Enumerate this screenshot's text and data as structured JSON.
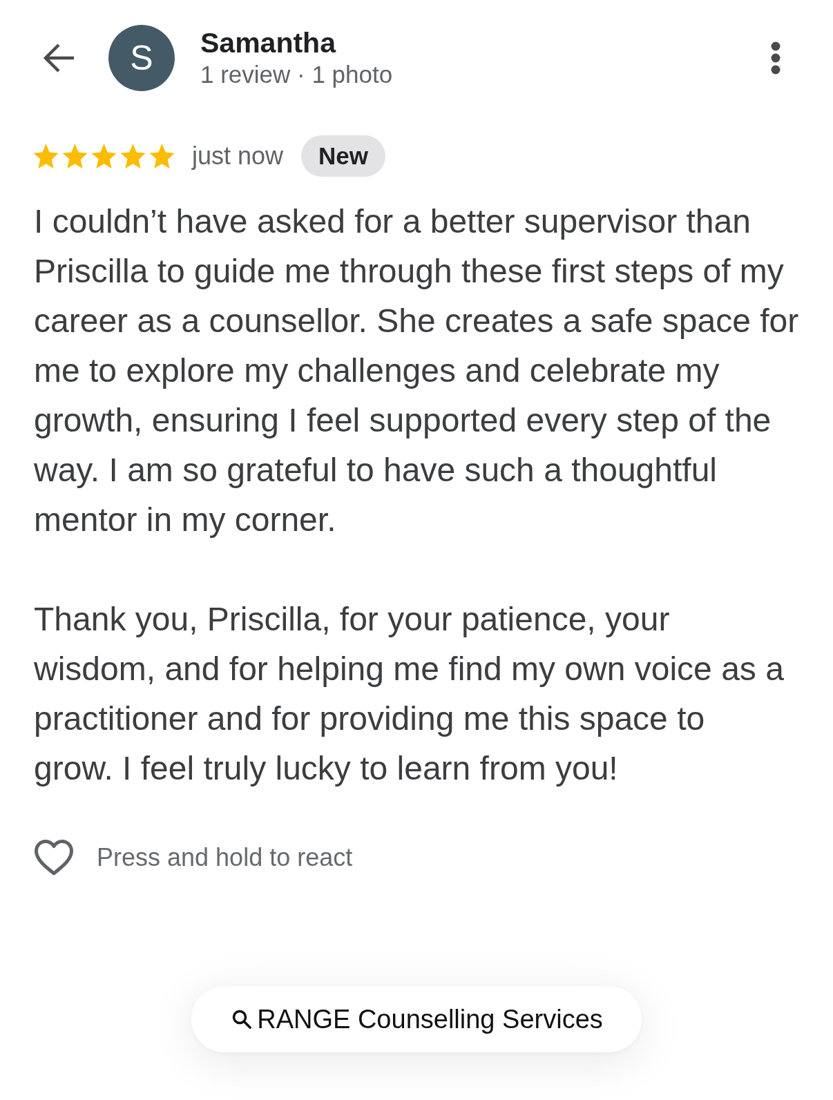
{
  "reviewer": {
    "avatar_letter": "S",
    "name": "Samantha",
    "stats": "1 review · 1 photo"
  },
  "review": {
    "stars": 5,
    "time": "just now",
    "badge": "New",
    "paragraphs": [
      {
        "lines": [
          "I couldn’t have asked for a better supervisor than",
          "Priscilla to guide me through these first steps of my",
          "career as a counsellor. She creates a safe space for",
          "me to explore my challenges and celebrate my",
          "growth, ensuring I feel supported every step of the",
          "way. I am so grateful to have such a thoughtful",
          "mentor in my corner."
        ]
      },
      {
        "lines": [
          "Thank you, Priscilla, for your patience, your",
          "wisdom, and for helping me find my own voice as a",
          "practitioner and for providing me this space to",
          "grow. I feel truly lucky to learn from you!"
        ]
      }
    ]
  },
  "reaction": {
    "hint": "Press and hold to react"
  },
  "search_chip": {
    "label": "RANGE Counselling Services"
  }
}
